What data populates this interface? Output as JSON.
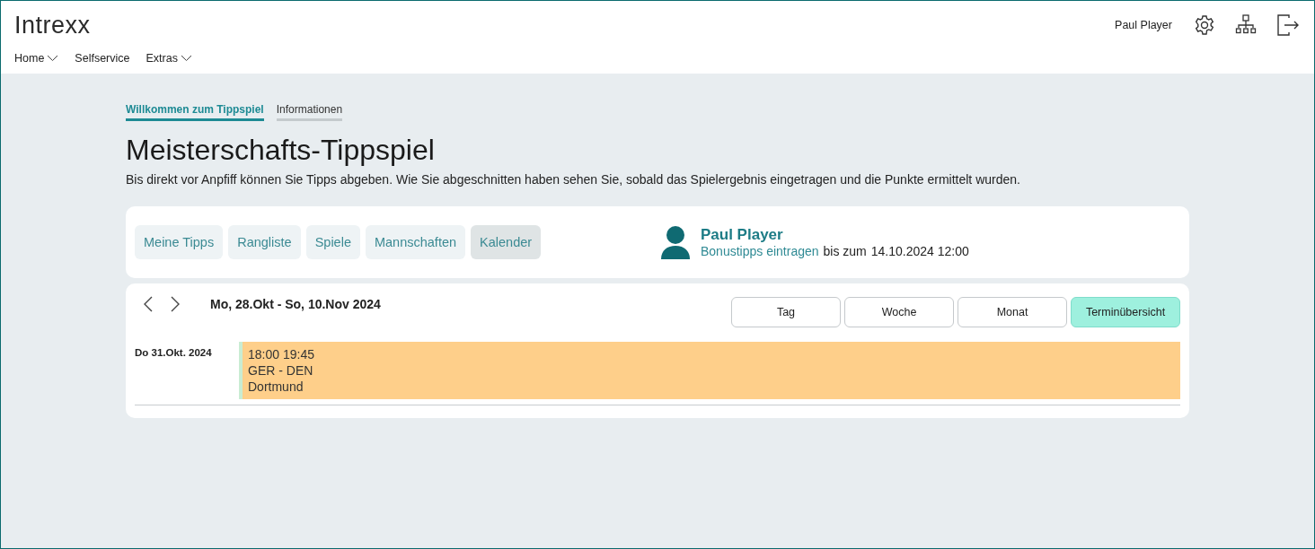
{
  "header": {
    "logo": "Intrexx",
    "user": "Paul Player",
    "menu": [
      {
        "label": "Home",
        "dropdown": true
      },
      {
        "label": "Selfservice",
        "dropdown": false
      },
      {
        "label": "Extras",
        "dropdown": true
      }
    ]
  },
  "tabs": [
    {
      "label": "Willkommen zum Tippspiel",
      "selected": true
    },
    {
      "label": "Informationen",
      "selected": false
    }
  ],
  "title": "Meisterschafts-Tippspiel",
  "intro": "Bis direkt vor Anpfiff können Sie Tipps abgeben. Wie Sie abgeschnitten haben sehen Sie, sobald das Spielergebnis eingetragen und die Punkte ermittelt wurden.",
  "nav": [
    {
      "label": "Meine Tipps",
      "selected": false
    },
    {
      "label": "Rangliste",
      "selected": false
    },
    {
      "label": "Spiele",
      "selected": false
    },
    {
      "label": "Mannschaften",
      "selected": false
    },
    {
      "label": "Kalender",
      "selected": true
    }
  ],
  "profile": {
    "name": "Paul Player",
    "link": "Bonustipps eintragen",
    "deadline_prefix": "bis zum",
    "deadline": "14.10.2024 12:00"
  },
  "calendar": {
    "range": "Mo, 28.Okt - So, 10.Nov 2024",
    "views": [
      {
        "label": "Tag",
        "selected": false
      },
      {
        "label": "Woche",
        "selected": false
      },
      {
        "label": "Monat",
        "selected": false
      },
      {
        "label": "Terminübersicht",
        "selected": true
      }
    ],
    "days": [
      {
        "date": "Do 31.Okt. 2024",
        "events": [
          {
            "time": "18:00 19:45",
            "title": "GER - DEN",
            "place": "Dortmund",
            "color": "#fecf8a"
          }
        ]
      }
    ]
  }
}
